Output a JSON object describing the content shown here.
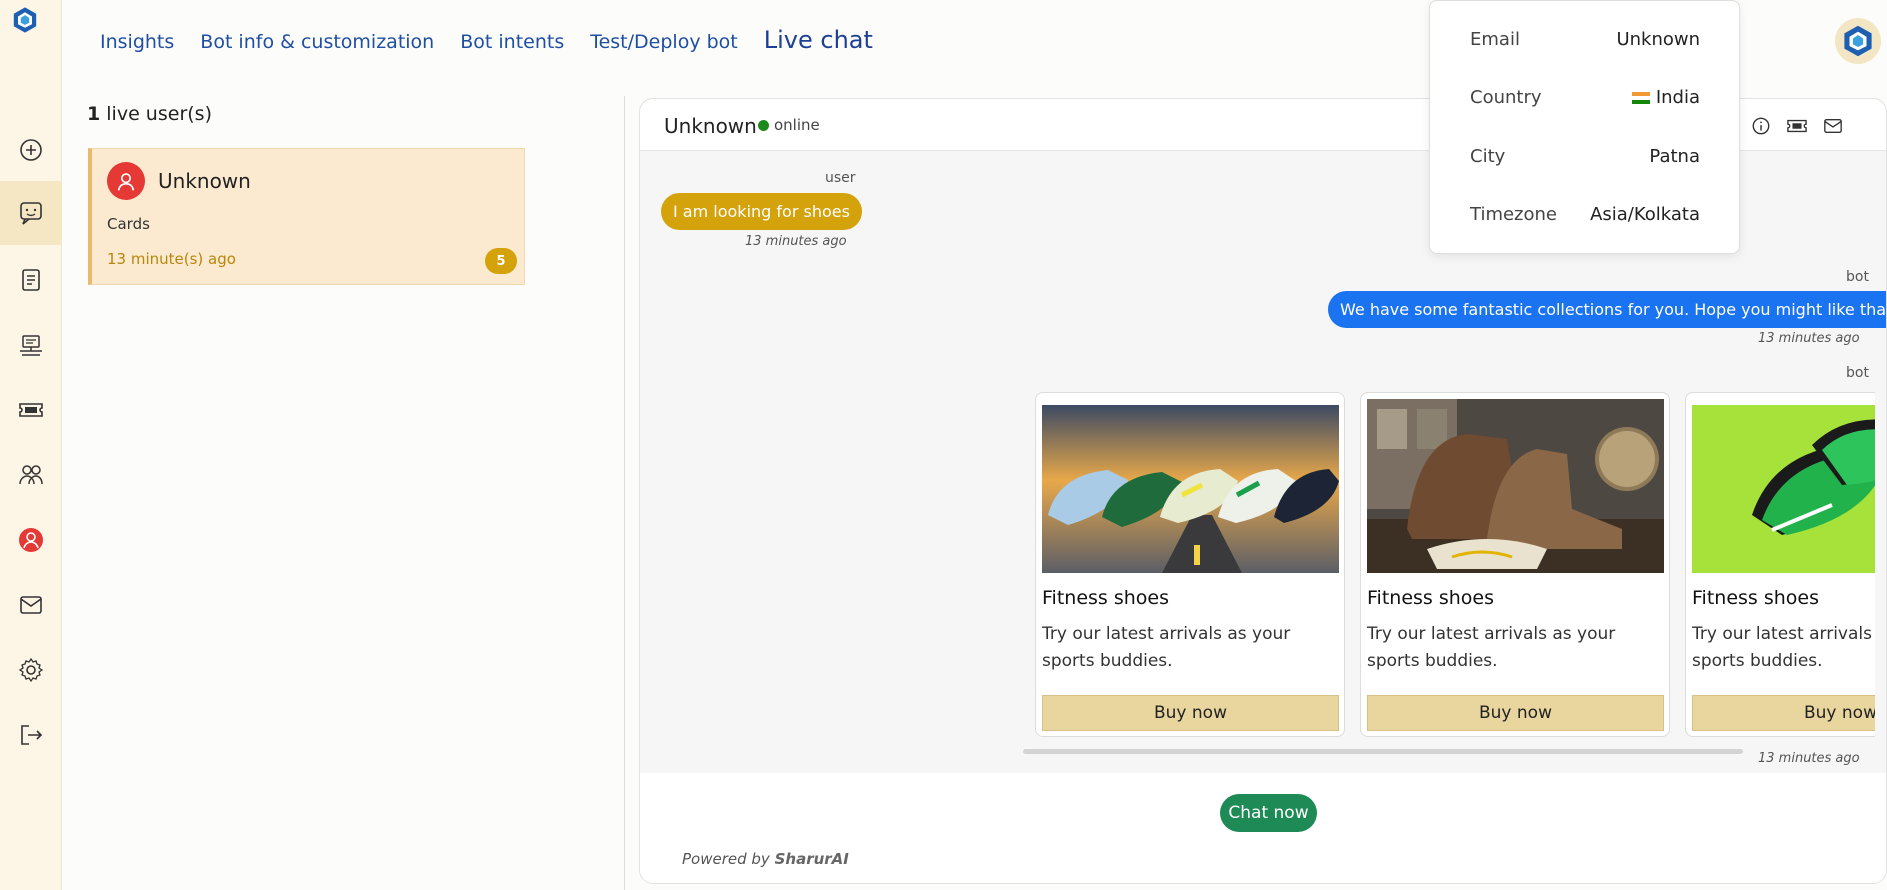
{
  "colors": {
    "accent_blue": "#1a73f0",
    "user_bubble": "#d4a20a",
    "chat_now": "#1e8a55",
    "rail_bg": "#fdf6e6",
    "card_button": "#e9d59e"
  },
  "nav": {
    "items": [
      {
        "label": "Insights"
      },
      {
        "label": "Bot info & customization"
      },
      {
        "label": "Bot intents"
      },
      {
        "label": "Test/Deploy bot"
      },
      {
        "label": "Live chat"
      }
    ]
  },
  "rail": {
    "icons": [
      "logo-icon",
      "add-icon",
      "chat-icon",
      "document-icon",
      "deploy-icon",
      "ticket-icon",
      "users-icon",
      "profile-icon",
      "mail-icon",
      "settings-icon",
      "logout-icon"
    ]
  },
  "users_panel": {
    "count": "1",
    "count_suffix": "live user(s)",
    "users": [
      {
        "name": "Unknown",
        "subtitle": "Cards",
        "time": "13 minute(s) ago",
        "badge": "5"
      }
    ]
  },
  "chat": {
    "header": {
      "name": "Unknown",
      "status": "online"
    },
    "messages": [
      {
        "sender": "user",
        "text": "I am looking for shoes",
        "time": "13 minutes ago"
      },
      {
        "sender": "bot",
        "text": "We have some fantastic collections for you. Hope you might like that.",
        "time": "13 minutes ago"
      },
      {
        "sender": "bot",
        "time": "13 minutes ago"
      }
    ],
    "cards": [
      {
        "title": "Fitness shoes",
        "description": "Try our latest arrivals as your sports buddies.",
        "button": "Buy now"
      },
      {
        "title": "Fitness shoes",
        "description": "Try our latest arrivals as your sports buddies.",
        "button": "Buy now"
      },
      {
        "title": "Fitness shoes",
        "description": "Try our latest arrivals as your sports buddies.",
        "button": "Buy now"
      }
    ],
    "chat_now": "Chat now",
    "powered_prefix": "Powered by",
    "powered_brand": "SharurAI"
  },
  "info_popover": {
    "rows": [
      {
        "key": "Email",
        "value": "Unknown"
      },
      {
        "key": "Country",
        "value": "India"
      },
      {
        "key": "City",
        "value": "Patna"
      },
      {
        "key": "Timezone",
        "value": "Asia/Kolkata"
      }
    ]
  }
}
